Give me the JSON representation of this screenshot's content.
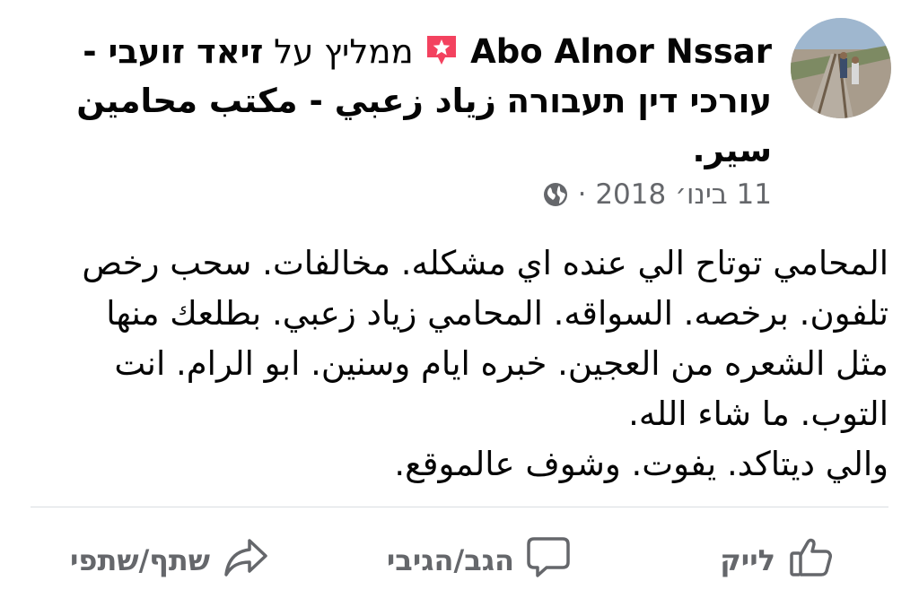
{
  "post": {
    "author": "Abo Alnor Nssar",
    "recommends_label": "ממליץ על",
    "page_name": "זיאד זועבי - עורכי דין תעבורה",
    "page_name_arabic": "زياد زعبي - مكتب محامين سير.",
    "date": "11 בינו׳ 2018",
    "separator": "·",
    "body_lines": [
      "المحامي توتاح الي عنده اي مشكله. مخالفات. سحب رخص",
      "تلفون. برخصه. السواقه. المحامي زياد زعبي. بطلعك منها",
      "مثل الشعره من العجين. خبره ايام وسنين. ابو الرام. انت",
      "التوب. ما شاء الله.",
      "والي ديتاكد. يفوت. وشوف عالموقع."
    ]
  },
  "actions": {
    "like_label": "לייק",
    "comment_label": "הגב/הגיבי",
    "share_label": "שתף/שתפי"
  },
  "icons": {
    "recommend": "recommend-star-icon",
    "globe": "globe-icon",
    "like": "thumbs-up-icon",
    "comment": "comment-bubble-icon",
    "share": "share-arrow-icon"
  },
  "colors": {
    "recommend_badge": "#f3425f",
    "secondary_text": "#65676b",
    "divider": "#dadde1"
  }
}
